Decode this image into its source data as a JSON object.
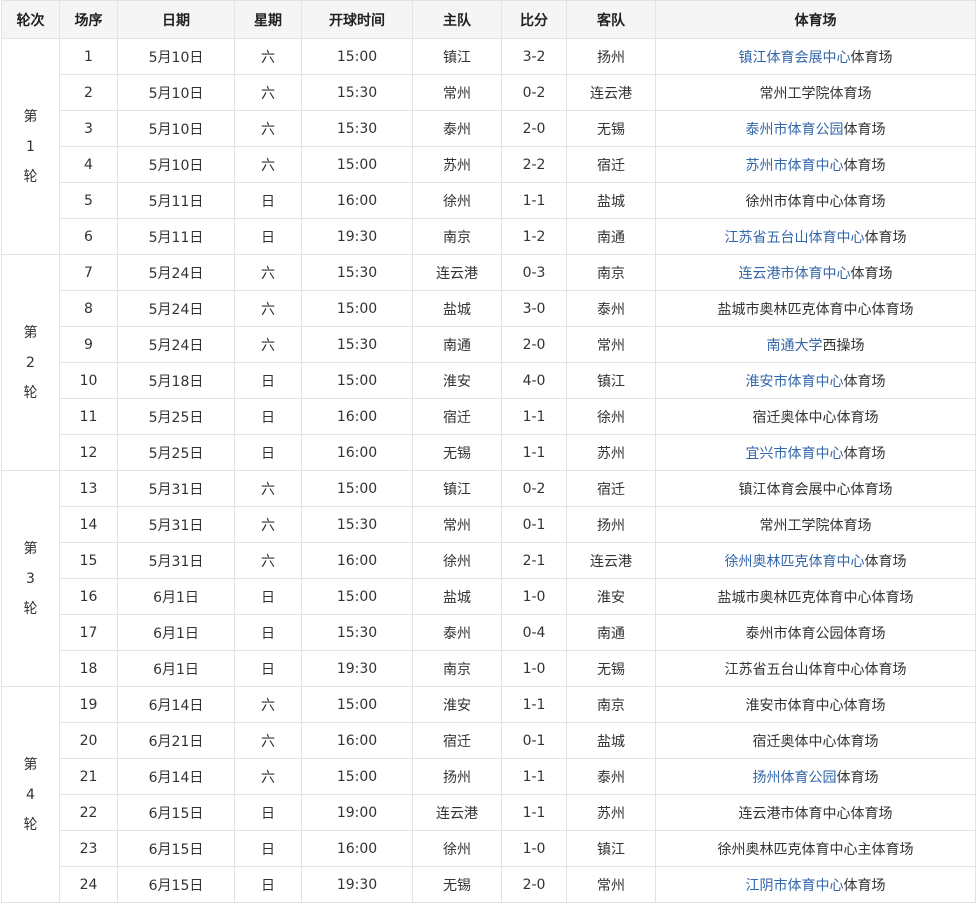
{
  "headers": [
    "轮次",
    "场序",
    "日期",
    "星期",
    "开球时间",
    "主队",
    "比分",
    "客队",
    "体育场"
  ],
  "rounds": [
    {
      "label": [
        "第",
        "1",
        "轮"
      ],
      "matches": [
        {
          "no": "1",
          "date": "5月10日",
          "weekday": "六",
          "time": "15:00",
          "home": "镇江",
          "score": "3-2",
          "away": "扬州",
          "venue_link": "镇江体育会展中心",
          "venue_rest": "体育场"
        },
        {
          "no": "2",
          "date": "5月10日",
          "weekday": "六",
          "time": "15:30",
          "home": "常州",
          "score": "0-2",
          "away": "连云港",
          "venue_link": "",
          "venue_rest": "常州工学院体育场"
        },
        {
          "no": "3",
          "date": "5月10日",
          "weekday": "六",
          "time": "15:30",
          "home": "泰州",
          "score": "2-0",
          "away": "无锡",
          "venue_link": "泰州市体育公园",
          "venue_rest": "体育场"
        },
        {
          "no": "4",
          "date": "5月10日",
          "weekday": "六",
          "time": "15:00",
          "home": "苏州",
          "score": "2-2",
          "away": "宿迁",
          "venue_link": "苏州市体育中心",
          "venue_rest": "体育场"
        },
        {
          "no": "5",
          "date": "5月11日",
          "weekday": "日",
          "time": "16:00",
          "home": "徐州",
          "score": "1-1",
          "away": "盐城",
          "venue_link": "",
          "venue_rest": "徐州市体育中心体育场"
        },
        {
          "no": "6",
          "date": "5月11日",
          "weekday": "日",
          "time": "19:30",
          "home": "南京",
          "score": "1-2",
          "away": "南通",
          "venue_link": "江苏省五台山体育中心",
          "venue_rest": "体育场"
        }
      ]
    },
    {
      "label": [
        "第",
        "2",
        "轮"
      ],
      "matches": [
        {
          "no": "7",
          "date": "5月24日",
          "weekday": "六",
          "time": "15:30",
          "home": "连云港",
          "score": "0-3",
          "away": "南京",
          "venue_link": "连云港市体育中心",
          "venue_rest": "体育场"
        },
        {
          "no": "8",
          "date": "5月24日",
          "weekday": "六",
          "time": "15:00",
          "home": "盐城",
          "score": "3-0",
          "away": "泰州",
          "venue_link": "",
          "venue_rest": "盐城市奥林匹克体育中心体育场"
        },
        {
          "no": "9",
          "date": "5月24日",
          "weekday": "六",
          "time": "15:30",
          "home": "南通",
          "score": "2-0",
          "away": "常州",
          "venue_link": "南通大学",
          "venue_rest": "西操场"
        },
        {
          "no": "10",
          "date": "5月18日",
          "weekday": "日",
          "time": "15:00",
          "home": "淮安",
          "score": "4-0",
          "away": "镇江",
          "venue_link": "淮安市体育中心",
          "venue_rest": "体育场"
        },
        {
          "no": "11",
          "date": "5月25日",
          "weekday": "日",
          "time": "16:00",
          "home": "宿迁",
          "score": "1-1",
          "away": "徐州",
          "venue_link": "",
          "venue_rest": "宿迁奥体中心体育场"
        },
        {
          "no": "12",
          "date": "5月25日",
          "weekday": "日",
          "time": "16:00",
          "home": "无锡",
          "score": "1-1",
          "away": "苏州",
          "venue_link": "宜兴市体育中心",
          "venue_rest": "体育场"
        }
      ]
    },
    {
      "label": [
        "第",
        "3",
        "轮"
      ],
      "matches": [
        {
          "no": "13",
          "date": "5月31日",
          "weekday": "六",
          "time": "15:00",
          "home": "镇江",
          "score": "0-2",
          "away": "宿迁",
          "venue_link": "",
          "venue_rest": "镇江体育会展中心体育场"
        },
        {
          "no": "14",
          "date": "5月31日",
          "weekday": "六",
          "time": "15:30",
          "home": "常州",
          "score": "0-1",
          "away": "扬州",
          "venue_link": "",
          "venue_rest": "常州工学院体育场"
        },
        {
          "no": "15",
          "date": "5月31日",
          "weekday": "六",
          "time": "16:00",
          "home": "徐州",
          "score": "2-1",
          "away": "连云港",
          "venue_link": "徐州奥林匹克体育中心",
          "venue_rest": "体育场"
        },
        {
          "no": "16",
          "date": "6月1日",
          "weekday": "日",
          "time": "15:00",
          "home": "盐城",
          "score": "1-0",
          "away": "淮安",
          "venue_link": "",
          "venue_rest": "盐城市奥林匹克体育中心体育场"
        },
        {
          "no": "17",
          "date": "6月1日",
          "weekday": "日",
          "time": "15:30",
          "home": "泰州",
          "score": "0-4",
          "away": "南通",
          "venue_link": "",
          "venue_rest": "泰州市体育公园体育场"
        },
        {
          "no": "18",
          "date": "6月1日",
          "weekday": "日",
          "time": "19:30",
          "home": "南京",
          "score": "1-0",
          "away": "无锡",
          "venue_link": "",
          "venue_rest": "江苏省五台山体育中心体育场"
        }
      ]
    },
    {
      "label": [
        "第",
        "4",
        "轮"
      ],
      "matches": [
        {
          "no": "19",
          "date": "6月14日",
          "weekday": "六",
          "time": "15:00",
          "home": "淮安",
          "score": "1-1",
          "away": "南京",
          "venue_link": "",
          "venue_rest": "淮安市体育中心体育场"
        },
        {
          "no": "20",
          "date": "6月21日",
          "weekday": "六",
          "time": "16:00",
          "home": "宿迁",
          "score": "0-1",
          "away": "盐城",
          "venue_link": "",
          "venue_rest": "宿迁奥体中心体育场"
        },
        {
          "no": "21",
          "date": "6月14日",
          "weekday": "六",
          "time": "15:00",
          "home": "扬州",
          "score": "1-1",
          "away": "泰州",
          "venue_link": "扬州体育公园",
          "venue_rest": "体育场"
        },
        {
          "no": "22",
          "date": "6月15日",
          "weekday": "日",
          "time": "19:00",
          "home": "连云港",
          "score": "1-1",
          "away": "苏州",
          "venue_link": "",
          "venue_rest": "连云港市体育中心体育场"
        },
        {
          "no": "23",
          "date": "6月15日",
          "weekday": "日",
          "time": "16:00",
          "home": "徐州",
          "score": "1-0",
          "away": "镇江",
          "venue_link": "",
          "venue_rest": "徐州奥林匹克体育中心主体育场"
        },
        {
          "no": "24",
          "date": "6月15日",
          "weekday": "日",
          "time": "19:30",
          "home": "无锡",
          "score": "2-0",
          "away": "常州",
          "venue_link": "江阴市体育中心",
          "venue_rest": "体育场"
        }
      ]
    }
  ]
}
